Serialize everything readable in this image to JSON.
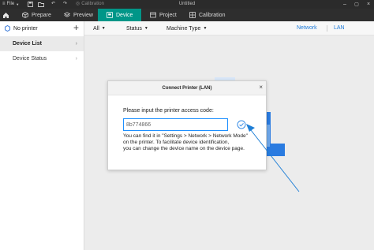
{
  "titlebar": {
    "file_label": "File",
    "calibration_label": "Calibration",
    "window_title": "Untitled"
  },
  "nav": {
    "tabs": [
      {
        "label": "Prepare",
        "icon": "cube-icon"
      },
      {
        "label": "Preview",
        "icon": "layers-icon"
      },
      {
        "label": "Device",
        "icon": "device-icon",
        "active": true
      },
      {
        "label": "Project",
        "icon": "project-icon"
      },
      {
        "label": "Calibration",
        "icon": "calibration-icon"
      }
    ]
  },
  "sidebar": {
    "printer_label": "No printer",
    "add_symbol": "+",
    "items": [
      {
        "label": "Device List",
        "active": true
      },
      {
        "label": "Device Status",
        "active": false
      }
    ]
  },
  "filters": {
    "all_label": "All",
    "status_label": "Status",
    "machine_type_label": "Machine Type",
    "network_label": "Network",
    "lan_label": "LAN"
  },
  "dialog": {
    "title": "Connect Printer (LAN)",
    "close_symbol": "×",
    "prompt": "Please input the printer access code:",
    "access_code": "8b774866",
    "help_line1": "You can find it in \"Settings > Network > Network Mode\"",
    "help_line2": "on the printer. To facilitate device identification,",
    "help_line3": "you can change the device name on the device page."
  },
  "colors": {
    "accent": "#009688",
    "link_blue": "#1e7bd9",
    "input_border": "#1e90ff"
  }
}
